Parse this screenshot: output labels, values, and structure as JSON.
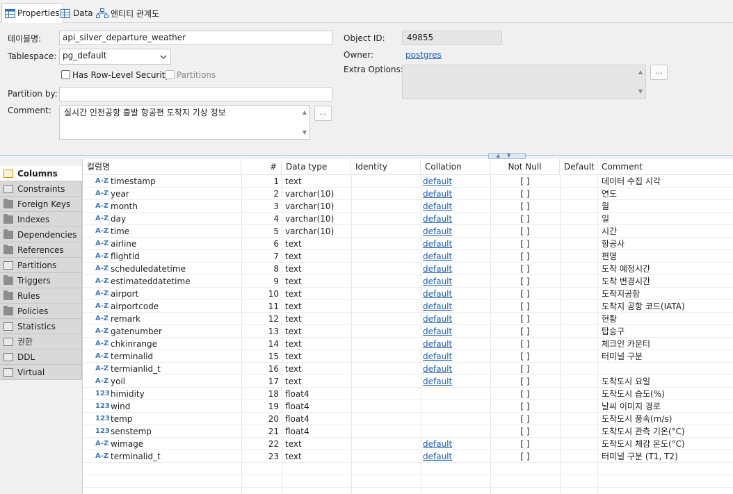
{
  "tabs": [
    {
      "label": "Properties",
      "icon": "table-icon"
    },
    {
      "label": "Data",
      "icon": "data-grid-icon"
    },
    {
      "label": "엔티티 관계도",
      "icon": "er-diagram-icon"
    }
  ],
  "form": {
    "table_name_label": "테이블명:",
    "table_name": "api_silver_departure_weather",
    "tablespace_label": "Tablespace:",
    "tablespace": "pg_default",
    "rls_label": "Has Row-Level Security",
    "partitions_label": "Partitions",
    "partition_by_label": "Partition by:",
    "partition_by": "",
    "comment_label": "Comment:",
    "comment": "실시간 인천공항 출발 항공편 도착지 기상 정보",
    "object_id_label": "Object ID:",
    "object_id": "49855",
    "owner_label": "Owner:",
    "owner": "postgres",
    "extra_options_label": "Extra Options:",
    "ellipsis": "..."
  },
  "left_tabs": [
    {
      "label": "Columns",
      "icon": "columns-icon"
    },
    {
      "label": "Constraints",
      "icon": "constraints-icon"
    },
    {
      "label": "Foreign Keys",
      "icon": "folder-icon"
    },
    {
      "label": "Indexes",
      "icon": "folder-icon"
    },
    {
      "label": "Dependencies",
      "icon": "folder-icon"
    },
    {
      "label": "References",
      "icon": "folder-icon"
    },
    {
      "label": "Partitions",
      "icon": "partitions-icon"
    },
    {
      "label": "Triggers",
      "icon": "folder-icon"
    },
    {
      "label": "Rules",
      "icon": "folder-icon"
    },
    {
      "label": "Policies",
      "icon": "folder-icon"
    },
    {
      "label": "Statistics",
      "icon": "statistics-icon"
    },
    {
      "label": "권한",
      "icon": "permissions-icon"
    },
    {
      "label": "DDL",
      "icon": "ddl-icon"
    },
    {
      "label": "Virtual",
      "icon": "virtual-icon"
    }
  ],
  "grid": {
    "headers": [
      "컬럼명",
      "#",
      "Data type",
      "Identity",
      "Collation",
      "Not Null",
      "Default",
      "Comment"
    ],
    "rows": [
      {
        "type_icon": "A-Z",
        "name": "timestamp",
        "num": "1",
        "dtype": "text",
        "collation": "default",
        "notnull": "[ ]",
        "comment": "데이터 수집 시각"
      },
      {
        "type_icon": "A-Z",
        "name": "year",
        "num": "2",
        "dtype": "varchar(10)",
        "collation": "default",
        "notnull": "[ ]",
        "comment": "연도"
      },
      {
        "type_icon": "A-Z",
        "name": "month",
        "num": "3",
        "dtype": "varchar(10)",
        "collation": "default",
        "notnull": "[ ]",
        "comment": "월"
      },
      {
        "type_icon": "A-Z",
        "name": "day",
        "num": "4",
        "dtype": "varchar(10)",
        "collation": "default",
        "notnull": "[ ]",
        "comment": "일"
      },
      {
        "type_icon": "A-Z",
        "name": "time",
        "num": "5",
        "dtype": "varchar(10)",
        "collation": "default",
        "notnull": "[ ]",
        "comment": "시간"
      },
      {
        "type_icon": "A-Z",
        "name": "airline",
        "num": "6",
        "dtype": "text",
        "collation": "default",
        "notnull": "[ ]",
        "comment": "항공사"
      },
      {
        "type_icon": "A-Z",
        "name": "flightid",
        "num": "7",
        "dtype": "text",
        "collation": "default",
        "notnull": "[ ]",
        "comment": "편명"
      },
      {
        "type_icon": "A-Z",
        "name": "scheduledatetime",
        "num": "8",
        "dtype": "text",
        "collation": "default",
        "notnull": "[ ]",
        "comment": "도착 예정시간"
      },
      {
        "type_icon": "A-Z",
        "name": "estimateddatetime",
        "num": "9",
        "dtype": "text",
        "collation": "default",
        "notnull": "[ ]",
        "comment": "도착 변경시간"
      },
      {
        "type_icon": "A-Z",
        "name": "airport",
        "num": "10",
        "dtype": "text",
        "collation": "default",
        "notnull": "[ ]",
        "comment": "도착지공항"
      },
      {
        "type_icon": "A-Z",
        "name": "airportcode",
        "num": "11",
        "dtype": "text",
        "collation": "default",
        "notnull": "[ ]",
        "comment": "도착지 공항 코드(IATA)"
      },
      {
        "type_icon": "A-Z",
        "name": "remark",
        "num": "12",
        "dtype": "text",
        "collation": "default",
        "notnull": "[ ]",
        "comment": "현황"
      },
      {
        "type_icon": "A-Z",
        "name": "gatenumber",
        "num": "13",
        "dtype": "text",
        "collation": "default",
        "notnull": "[ ]",
        "comment": "탑승구"
      },
      {
        "type_icon": "A-Z",
        "name": "chkinrange",
        "num": "14",
        "dtype": "text",
        "collation": "default",
        "notnull": "[ ]",
        "comment": "체크인 카운터"
      },
      {
        "type_icon": "A-Z",
        "name": "terminalid",
        "num": "15",
        "dtype": "text",
        "collation": "default",
        "notnull": "[ ]",
        "comment": "터미널 구분"
      },
      {
        "type_icon": "A-Z",
        "name": "termianlid_t",
        "num": "16",
        "dtype": "text",
        "collation": "default",
        "notnull": "[ ]",
        "comment": ""
      },
      {
        "type_icon": "A-Z",
        "name": "yoil",
        "num": "17",
        "dtype": "text",
        "collation": "default",
        "notnull": "[ ]",
        "comment": "도착도시 요일"
      },
      {
        "type_icon": "123",
        "name": "himidity",
        "num": "18",
        "dtype": "float4",
        "collation": "",
        "notnull": "[ ]",
        "comment": "도착도시 습도(%)"
      },
      {
        "type_icon": "123",
        "name": "wind",
        "num": "19",
        "dtype": "float4",
        "collation": "",
        "notnull": "[ ]",
        "comment": "날씨 이미지 경로"
      },
      {
        "type_icon": "123",
        "name": "temp",
        "num": "20",
        "dtype": "float4",
        "collation": "",
        "notnull": "[ ]",
        "comment": "도착도시 풍속(m/s)"
      },
      {
        "type_icon": "123",
        "name": "senstemp",
        "num": "21",
        "dtype": "float4",
        "collation": "",
        "notnull": "[ ]",
        "comment": "도착도시 관측 기온(°C)"
      },
      {
        "type_icon": "A-Z",
        "name": "wimage",
        "num": "22",
        "dtype": "text",
        "collation": "default",
        "notnull": "[ ]",
        "comment": "도착도시 체감 온도(°C)"
      },
      {
        "type_icon": "A-Z",
        "name": "terminalid_t",
        "num": "23",
        "dtype": "text",
        "collation": "default",
        "notnull": "[ ]",
        "comment": "터미널 구분 (T1, T2)"
      }
    ]
  },
  "colors": {
    "link": "#1a5fb4",
    "type_icon": "#3a78c2",
    "splitter": "#a9c6e8"
  }
}
